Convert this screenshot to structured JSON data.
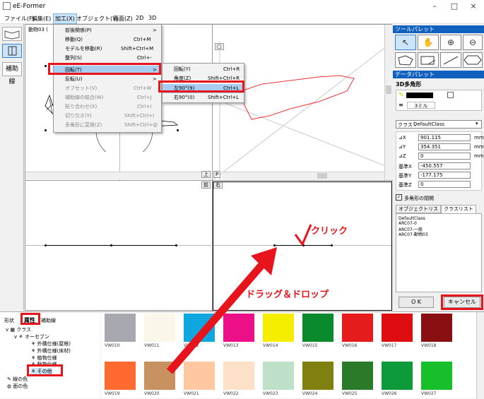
{
  "window": {
    "title": "eE-Former",
    "minimize": "–",
    "maximize": "□",
    "close": "×"
  },
  "menubar": [
    "ファイル(F)",
    "編集(E)",
    "加工(X)",
    "オブジェクト(Y)",
    "画面(Z)",
    "2D",
    "3D"
  ],
  "left_tools": {
    "hojosen": "補助線"
  },
  "canvas": {
    "tab_title": "動物03 (",
    "view_tabs": {
      "top": "上",
      "p": "P",
      "front": "前",
      "right": "右"
    }
  },
  "edit_menu": [
    {
      "label": "前後関係(P)",
      "shortcut": "",
      "arrow": ">",
      "disabled": false
    },
    {
      "label": "移動(Q)",
      "shortcut": "Ctrl+M",
      "arrow": "",
      "disabled": false
    },
    {
      "label": "モデルを移動(R)",
      "shortcut": "Shift+Ctrl+M",
      "arrow": "",
      "disabled": false
    },
    {
      "label": "整列(S)",
      "shortcut": "Ctrl+-",
      "arrow": "",
      "disabled": false
    },
    {
      "label": "回転(T)",
      "shortcut": "",
      "arrow": ">",
      "disabled": false,
      "highlight": true
    },
    {
      "label": "反転(U)",
      "shortcut": "",
      "arrow": ">",
      "disabled": false
    },
    {
      "label": "オフセット(V)",
      "shortcut": "Ctrl+W",
      "arrow": "",
      "disabled": true
    },
    {
      "label": "補助線の結合(W)",
      "shortcut": "Ctrl+J",
      "arrow": "",
      "disabled": true
    },
    {
      "label": "貼り合わせ(X)",
      "shortcut": "Ctrl+I",
      "arrow": "",
      "disabled": true
    },
    {
      "label": "切り欠き(Y)",
      "shortcut": "Shift+Ctrl+I",
      "arrow": "",
      "disabled": true
    },
    {
      "label": "多角形に変換(Z)",
      "shortcut": "Shift+Ctrl+@",
      "arrow": "",
      "disabled": true
    }
  ],
  "rotate_submenu": [
    {
      "label": "回転(Y)",
      "shortcut": "Ctrl+R"
    },
    {
      "label": "角度(Z)",
      "shortcut": "Shift+Ctrl+R"
    },
    {
      "label": "左90°(9)",
      "shortcut": "Ctrl+L",
      "highlight": true
    },
    {
      "label": "右90°(0)",
      "shortcut": "Shift+Ctrl+L"
    }
  ],
  "tool_palette": {
    "title": "ツールパレット"
  },
  "data_palette": {
    "title": "データパレット",
    "shape": "3D多角形",
    "line_width": "3ミル",
    "class_label": "クラス :",
    "class_value": "DefaultClass",
    "fields": [
      {
        "label": "⊿X",
        "value": "901.115",
        "unit": "mm"
      },
      {
        "label": "⊿Y",
        "value": "354.351",
        "unit": "mm"
      },
      {
        "label": "⊿Z",
        "value": "0",
        "unit": "mm"
      },
      {
        "label": "基準X",
        "value": "-450.557",
        "unit": ""
      },
      {
        "label": "基準Y",
        "value": "-177.175",
        "unit": ""
      },
      {
        "label": "基準Z",
        "value": "0",
        "unit": ""
      }
    ],
    "closed_polygon": "多角形の閉開",
    "tabs": [
      "オブジェクトリスト",
      "クラスリスト"
    ],
    "class_list": [
      "DefaultClass",
      "ARC07-0",
      "ARC07-一般",
      "ARC07-動物03"
    ],
    "ok": "O K",
    "cancel": "キャンセル"
  },
  "bottom_tabs": [
    "形状",
    "属性",
    "補助線"
  ],
  "tree": [
    {
      "label": "クラス",
      "indent": 0
    },
    {
      "label": "オーセブン",
      "indent": 1
    },
    {
      "label": "外構仕様(屋根)",
      "indent": 2
    },
    {
      "label": "外構仕様(床材)",
      "indent": 2
    },
    {
      "label": "植物仕様",
      "indent": 2
    },
    {
      "label": "動物仕様",
      "indent": 2
    },
    {
      "label": "その他",
      "indent": 2,
      "highlight": true
    },
    {
      "label": "線の色",
      "indent": 0
    },
    {
      "label": "面の色",
      "indent": 0
    }
  ],
  "swatches_row1": [
    {
      "name": "VW010",
      "color": "#a8a8b0"
    },
    {
      "name": "VW011",
      "color": "#fbf6ea"
    },
    {
      "name": "VW012",
      "color": "#0ea7e0"
    },
    {
      "name": "VW013",
      "color": "#ed0f88"
    },
    {
      "name": "VW014",
      "color": "#f5ee00"
    },
    {
      "name": "VW015",
      "color": "#098a2d"
    },
    {
      "name": "VW016",
      "color": "#e61b1b"
    },
    {
      "name": "VW017",
      "color": "#dd0d12"
    },
    {
      "name": "VW018",
      "color": "#8a0f12"
    }
  ],
  "swatches_row2": [
    {
      "name": "VW019",
      "color": "#ff6a30"
    },
    {
      "name": "VW020",
      "color": "#c89260"
    },
    {
      "name": "VW021",
      "color": "#ffc8a0"
    },
    {
      "name": "VW022",
      "color": "#fde0c8"
    },
    {
      "name": "VW023",
      "color": "#bfe0c8"
    },
    {
      "name": "VW024",
      "color": "#808010"
    },
    {
      "name": "VW025",
      "color": "#2a7a2a"
    },
    {
      "name": "VW026",
      "color": "#0c9a3a"
    },
    {
      "name": "VW027",
      "color": "#17c02a"
    }
  ],
  "annotations": {
    "click": "クリック",
    "drag_drop": "ドラッグ＆ドロップ"
  },
  "colors": {
    "accent": "#1060c0",
    "annotation_red": "#e8141c"
  }
}
